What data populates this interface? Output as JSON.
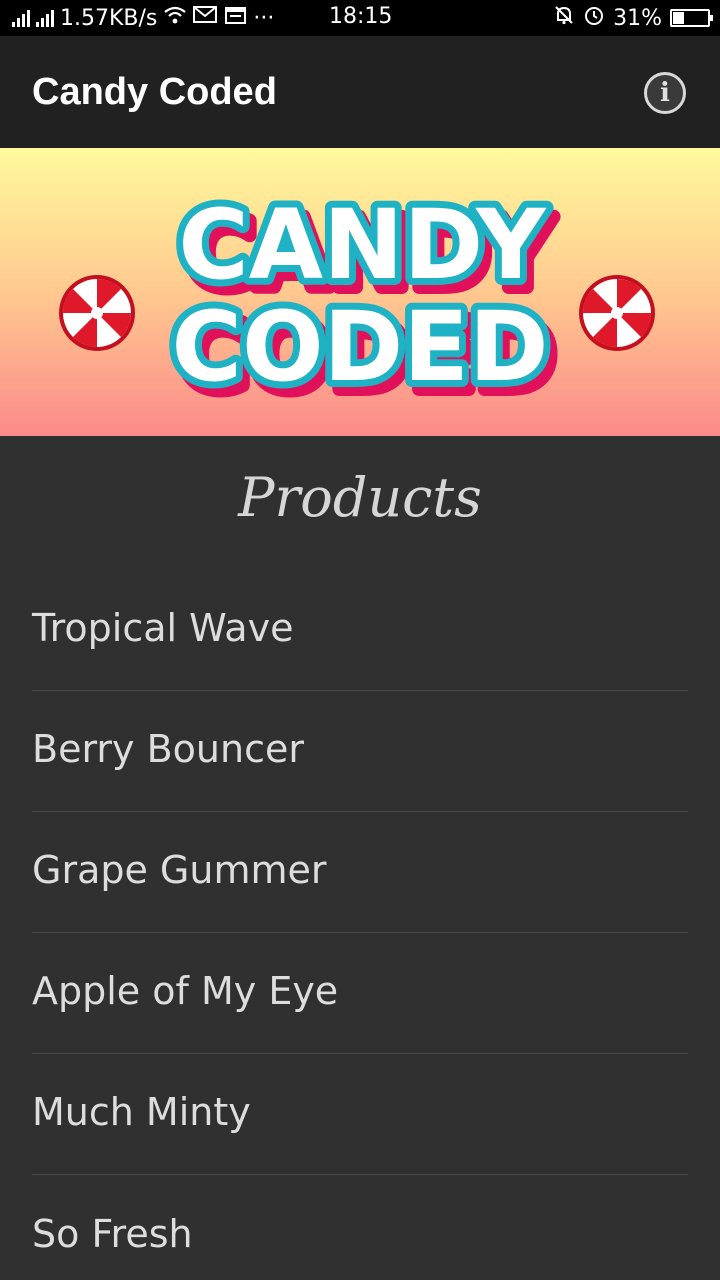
{
  "status_bar": {
    "network_speed": "1.57KB/s",
    "time": "18:15",
    "battery_percent": "31%",
    "battery_level": 0.31,
    "icons": [
      "signal-icon",
      "signal-icon",
      "wifi-icon",
      "mail-icon",
      "calendar-icon",
      "more-icon",
      "mute-icon",
      "alarm-icon",
      "battery-icon"
    ],
    "more": "···"
  },
  "app_bar": {
    "title": "Candy Coded",
    "info_glyph": "i"
  },
  "banner": {
    "logo_line1": "CANDY",
    "logo_line2": "CODED",
    "colors": {
      "fill": "#ffffff",
      "outline": "#1fb2c4",
      "shadow": "#e0105a",
      "gradient_top": "#fffa9c",
      "gradient_bottom": "#fb8a8a"
    }
  },
  "products": {
    "heading": "Products",
    "items": [
      "Tropical Wave",
      "Berry Bouncer",
      "Grape Gummer",
      "Apple of My Eye",
      "Much Minty",
      "So Fresh"
    ]
  }
}
